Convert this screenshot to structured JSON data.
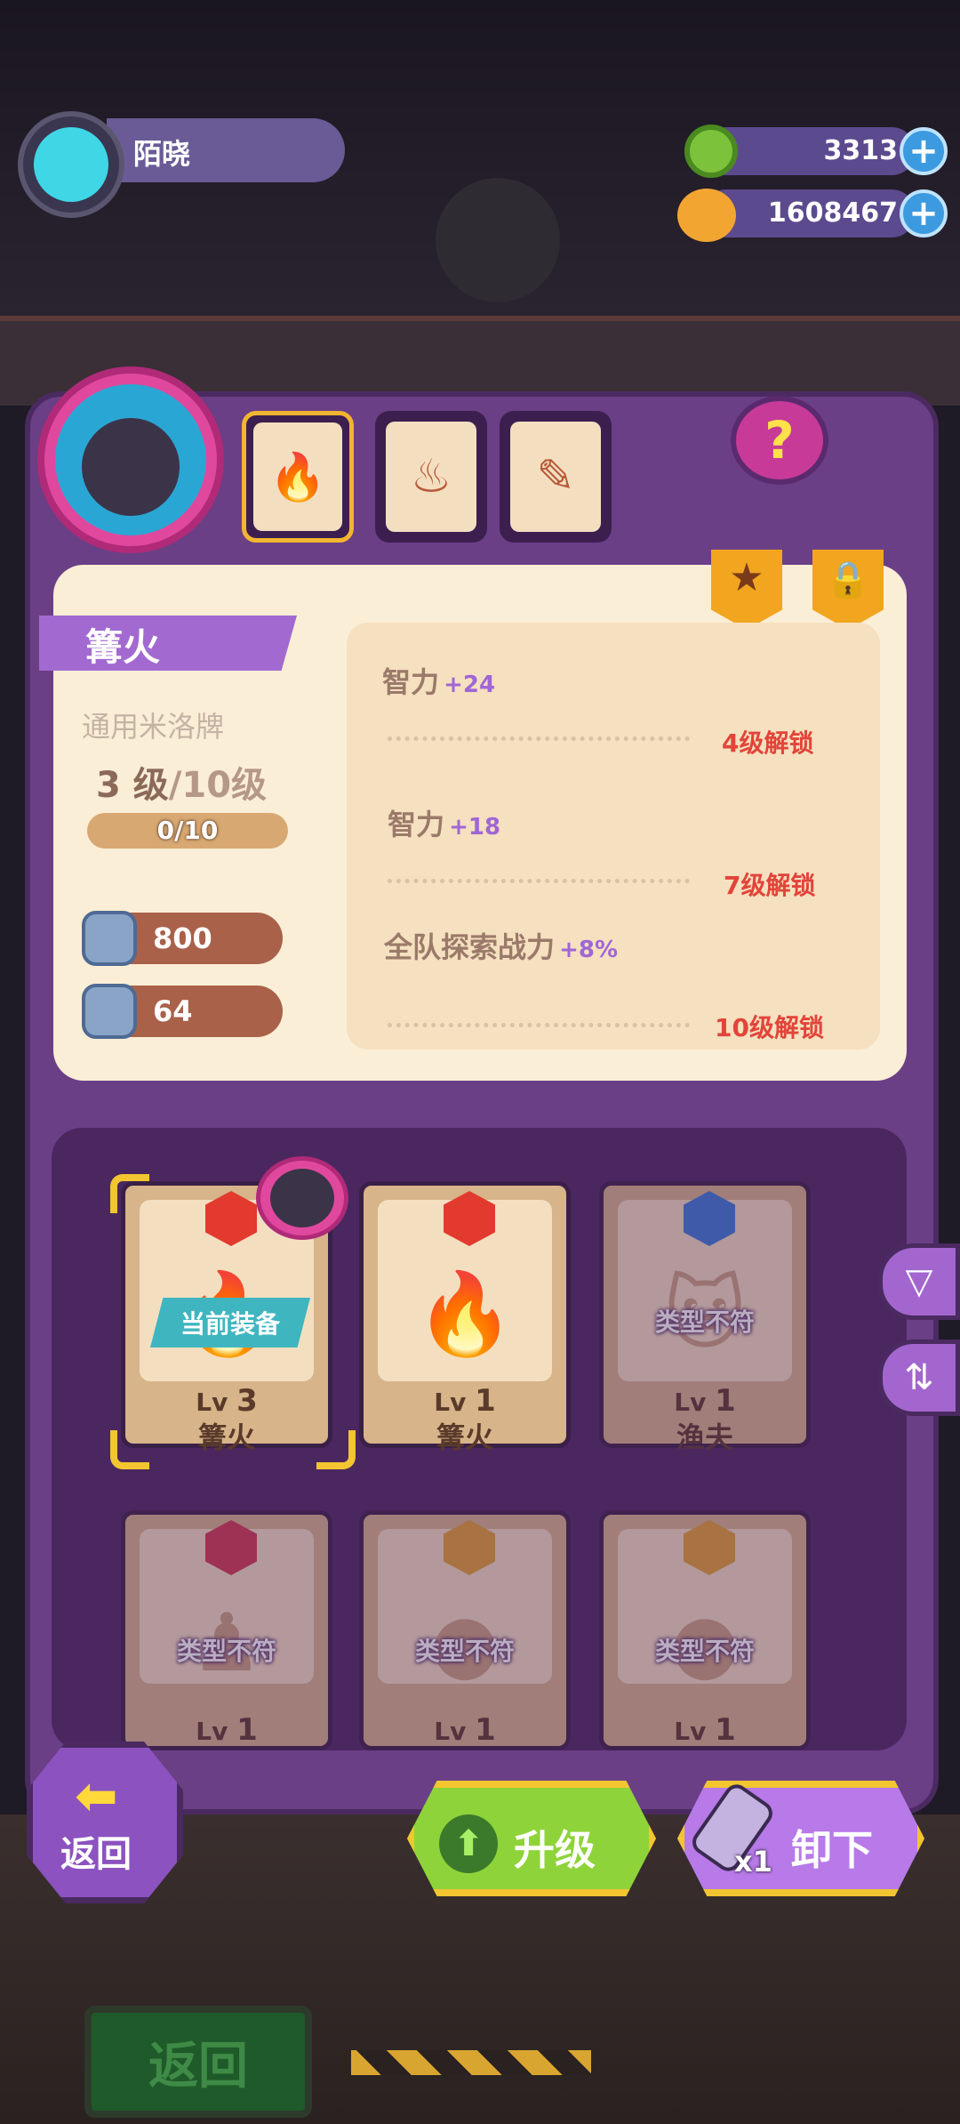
{
  "header": {
    "username": "陌晓",
    "currencies": [
      {
        "name": "donut-currency",
        "value": "3313"
      },
      {
        "name": "planet-currency",
        "value": "1608467"
      }
    ],
    "plus_symbol": "+"
  },
  "tabs": [
    {
      "name": "campfire-tab",
      "icon": "campfire-icon",
      "glyph": "🔥",
      "selected": true
    },
    {
      "name": "brazier-tab",
      "icon": "brazier-icon",
      "glyph": "♨",
      "selected": false
    },
    {
      "name": "torch-tab",
      "icon": "torch-icon",
      "glyph": "✎",
      "selected": false
    }
  ],
  "help_label": "?",
  "card": {
    "title": "篝火",
    "subtitle": "通用米洛牌",
    "level_current": "3 级",
    "level_max": "/10级",
    "progress_text": "0/10",
    "progress_fraction": 0,
    "stats": [
      {
        "icon": "heart-shield-icon",
        "value": "800"
      },
      {
        "icon": "shield-icon",
        "value": "64"
      }
    ],
    "tags": {
      "star": "★",
      "lock": "🔒"
    },
    "attributes": [
      {
        "name": "智力",
        "bonus": "+24",
        "unlock": "4级解锁"
      },
      {
        "name": "智力",
        "bonus": "+18",
        "unlock": "7级解锁"
      },
      {
        "name": "全队探索战力",
        "bonus": "+8%",
        "unlock": "10级解锁"
      }
    ]
  },
  "grid": {
    "lv_prefix": "Lv",
    "current_badge": "当前装备",
    "mismatch_label": "类型不符",
    "items": [
      {
        "name": "篝火",
        "level": "3",
        "rarity_color": "#e23a2e",
        "art": "🔥",
        "current": true,
        "mismatch": false
      },
      {
        "name": "篝火",
        "level": "1",
        "rarity_color": "#e23a2e",
        "art": "🔥",
        "current": false,
        "mismatch": false
      },
      {
        "name": "渔夫",
        "level": "1",
        "rarity_color": "#3a7ad8",
        "art": "🐱",
        "current": false,
        "mismatch": true
      },
      {
        "name": "",
        "level": "1",
        "rarity_color": "#d23a4e",
        "art": "♟",
        "current": false,
        "mismatch": true
      },
      {
        "name": "",
        "level": "1",
        "rarity_color": "#e2a031",
        "art": "●",
        "current": false,
        "mismatch": true
      },
      {
        "name": "",
        "level": "1",
        "rarity_color": "#e2a031",
        "art": "●",
        "current": false,
        "mismatch": true
      }
    ]
  },
  "side_buttons": {
    "filter": "▽",
    "sort": "⇅"
  },
  "bottom": {
    "back_label": "返回",
    "back_arrow": "⬅",
    "upgrade_label": "升级",
    "upgrade_arrow": "⬆",
    "unequip_label": "卸下",
    "unequip_count": "x1"
  },
  "background": {
    "old_back_label": "返回"
  }
}
